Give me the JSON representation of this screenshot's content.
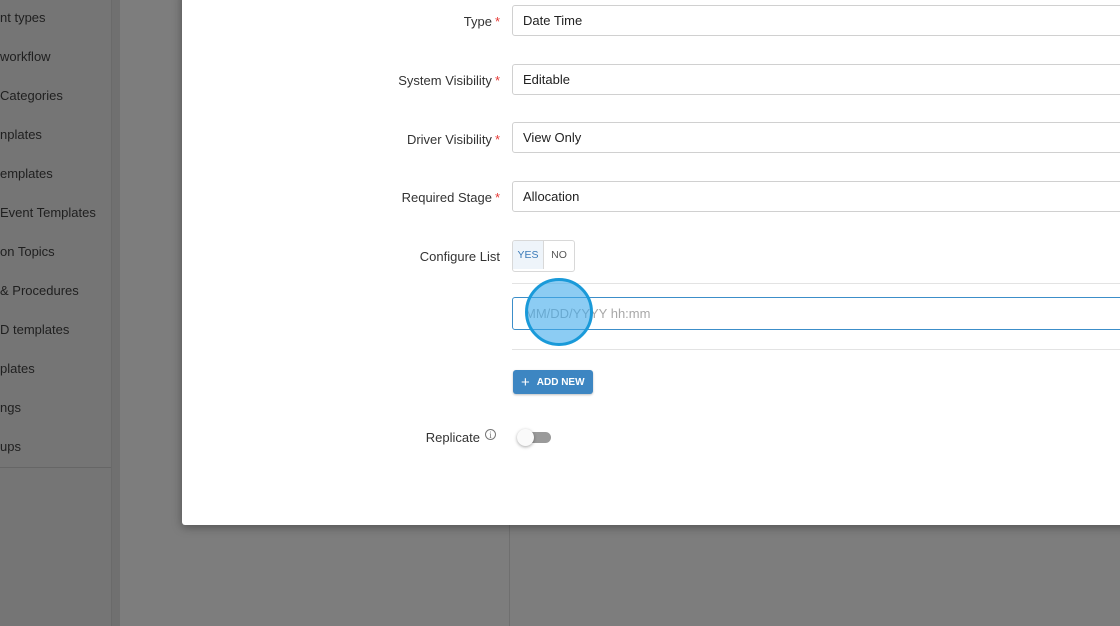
{
  "sidebar": {
    "items": [
      "nt types",
      " workflow",
      "Categories",
      "nplates",
      "emplates",
      "Event Templates",
      "on Topics",
      "& Procedures",
      "D templates",
      "plates",
      "ngs",
      "ups"
    ]
  },
  "form": {
    "type": {
      "label": "Type",
      "value": "Date Time",
      "required": "*"
    },
    "system_visibility": {
      "label": "System Visibility",
      "value": "Editable",
      "required": "*"
    },
    "driver_visibility": {
      "label": "Driver Visibility",
      "value": "View Only",
      "required": "*"
    },
    "required_stage": {
      "label": "Required Stage",
      "value": "Allocation",
      "required": "*"
    },
    "configure_list": {
      "label": "Configure List",
      "yes": "YES",
      "no": "NO",
      "selected": "YES"
    },
    "list_entry": {
      "placeholder": "MM/DD/YYYY hh:mm",
      "value": ""
    },
    "add_new_label": "ADD NEW",
    "replicate": {
      "label": "Replicate",
      "enabled": false
    }
  },
  "icons": {
    "info": "info-icon",
    "plus": "plus-icon"
  },
  "colors": {
    "accent": "#3d86c2",
    "required": "#e53935",
    "focus_border": "#3c8ec9",
    "click_indicator": "#1a9ad9"
  }
}
